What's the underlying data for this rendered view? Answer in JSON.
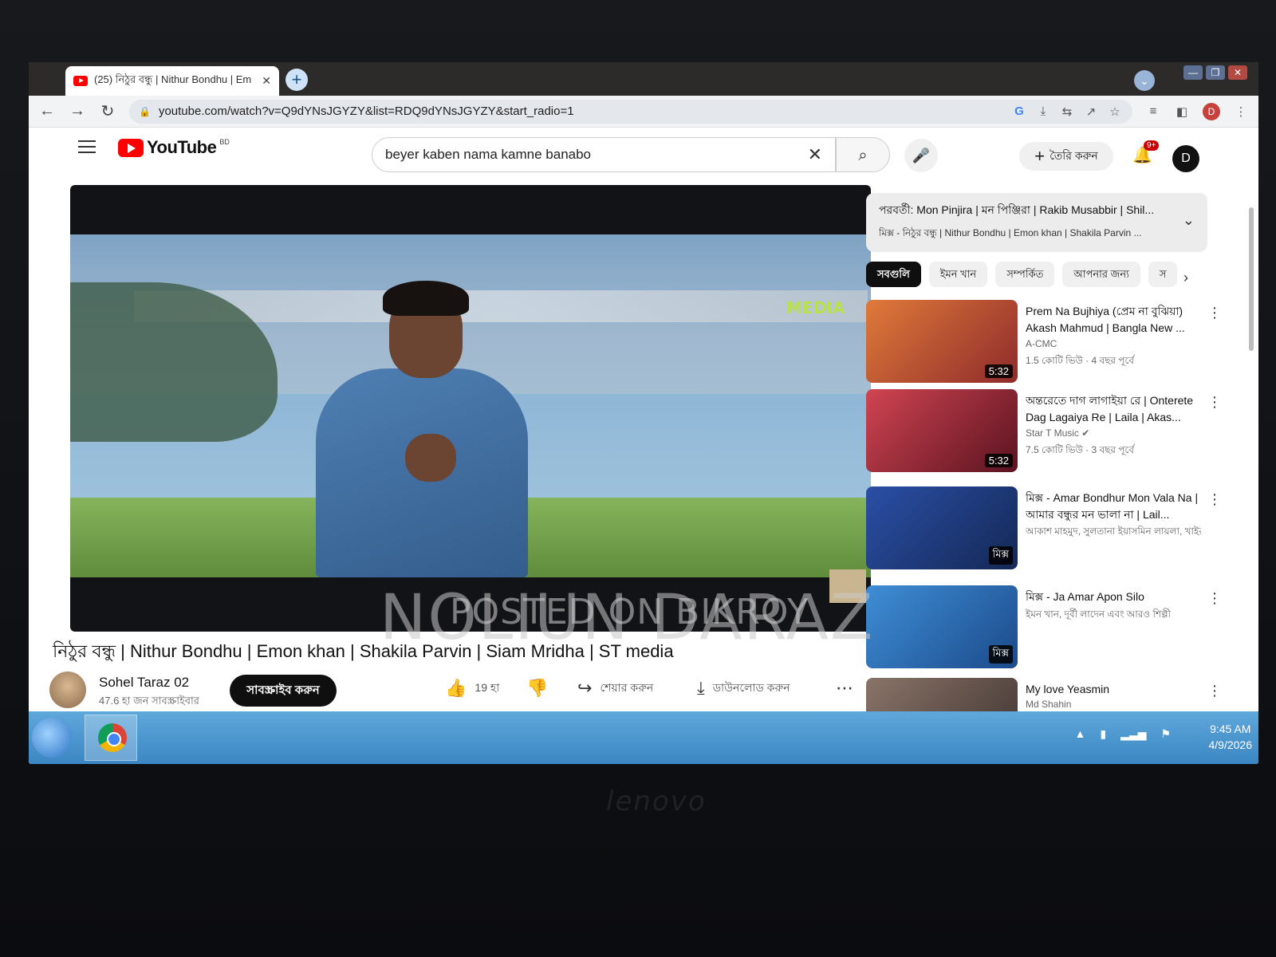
{
  "browser": {
    "tab_title": "(25) নিঠুর বন্ধু | Nithur Bondhu | Em",
    "url": "youtube.com/watch?v=Q9dYNsJGYZY&list=RDQ9dYNsJGYZY&start_radio=1",
    "profile_initial": "D"
  },
  "youtube": {
    "logo_text": "YouTube",
    "country_code": "BD",
    "search_value": "beyer kaben nama  kamne banabo",
    "create_label": "তৈরি করুন",
    "notif_count": "9+",
    "avatar_initial": "D"
  },
  "player": {
    "channel_logo": "MEDIA"
  },
  "watermark": {
    "line1": "POSTED ON BIKROY",
    "line2": "NOLIUN DARAZ"
  },
  "video": {
    "title": "নিঠুর বন্ধু | Nithur Bondhu | Emon khan | Shakila Parvin | Siam Mridha | ST media",
    "channel": "Sohel Taraz 02",
    "subscribers": "47.6 হা জন সাবস্ক্রাইবার",
    "subscribe_label": "সাবস্ক্রাইব করুন",
    "likes": "19 হা",
    "share_label": "শেয়ার করুন",
    "download_label": "ডাউনলোড করুন"
  },
  "upnext": {
    "line1": "পরবর্তী: Mon Pinjira | মন পিঞ্জিরা | Rakib Musabbir | Shil...",
    "line2": "মিক্স - নিঠুর বন্ধু | Nithur Bondhu | Emon khan | Shakila Parvin ..."
  },
  "chips": [
    "সবগুলি",
    "ইমন খান",
    "সম্পর্কিত",
    "আপনার জন্য",
    "স"
  ],
  "recommendations": [
    {
      "title": "Prem Na Bujhiya (প্রেম না বুঝিয়া) Akash Mahmud | Bangla New ...",
      "channel": "A-CMC",
      "meta": "1.5 কোটি ভিউ · 4 বছর পূর্বে",
      "duration": "5:32",
      "thumb_color": "#c9542e"
    },
    {
      "title": "অন্তরেতে দাগ লাগাইয়া রে | Onterete Dag Lagaiya Re | Laila | Akas...",
      "channel": "Star T Music ✔",
      "meta": "7.5 কোটি ভিউ · 3 বছর পূর্বে",
      "duration": "5:32",
      "thumb_color": "#b8303b"
    },
    {
      "title": "মিক্স - Amar Bondhur Mon Vala Na | আমার বন্ধুর মন ভালা না | Lail...",
      "channel": "আকাশ মাহমুদ, সুলতানা ইয়াসমিন লায়লা, খাইরুল ...",
      "meta": "",
      "duration": "মিক্স",
      "thumb_color": "#1f3f86"
    },
    {
      "title": "মিক্স - Ja Amar Apon Silo",
      "channel": "ইমন খান, দূর্বী লাদেন এবং আরও শিল্পী",
      "meta": "",
      "duration": "মিক্স",
      "thumb_color": "#2f79c0"
    },
    {
      "title": "My love Yeasmin",
      "channel": "Md Shahin",
      "meta": "",
      "duration": "",
      "thumb_color": "#6c5a52"
    }
  ],
  "taskbar": {
    "time": "9:45 AM",
    "date": "4/9/2026"
  },
  "bezel": {
    "brand": "lenovo"
  }
}
